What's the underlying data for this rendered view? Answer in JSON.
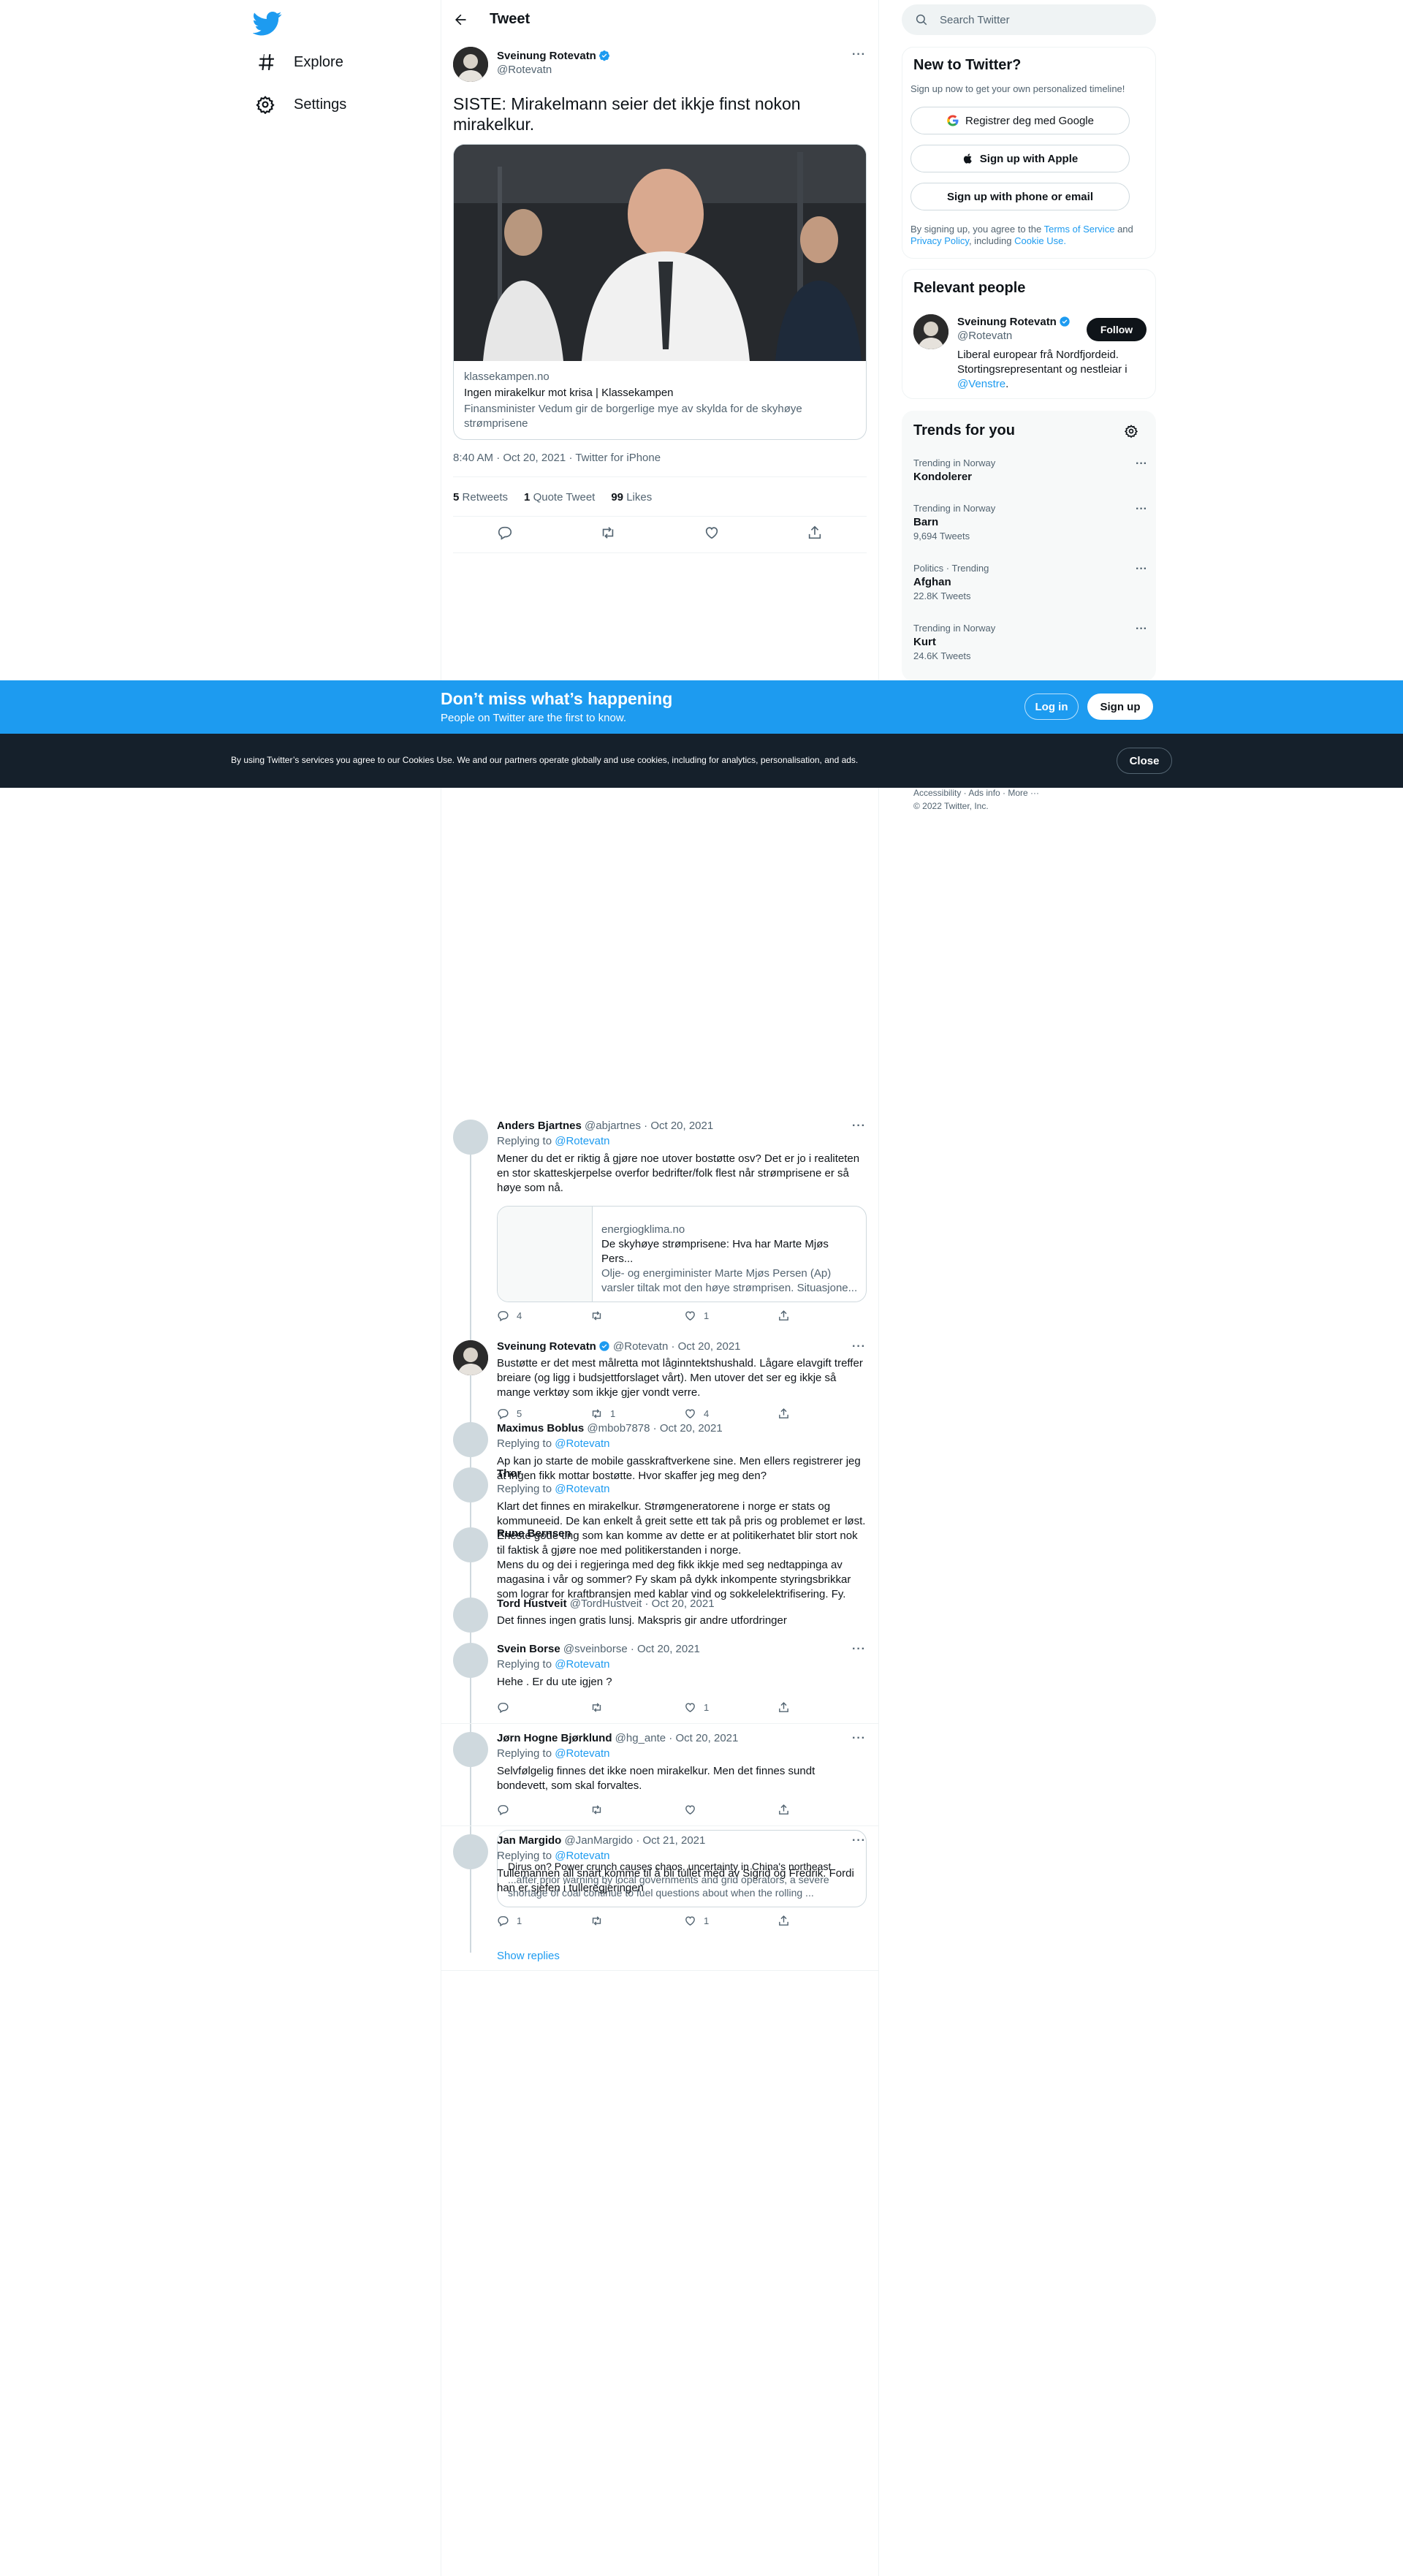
{
  "nav": {
    "explore": "Explore",
    "settings": "Settings"
  },
  "header": {
    "title": "Tweet"
  },
  "tweet": {
    "author_name": "Sveinung Rotevatn",
    "author_handle": "@Rotevatn",
    "text": "SISTE: Mirakelmann seier det ikkje finst nokon mirakelkur.",
    "card": {
      "domain": "klassekampen.no",
      "title": "Ingen mirakelkur mot krisa | Klassekampen",
      "description": "Finansminister Vedum gir de borgerlige mye av skylda for de skyhøye strømprisene"
    },
    "time": "8:40 AM · Oct 20, 2021",
    "source": "Twitter for iPhone",
    "retweets": "5",
    "retweets_label": "Retweets",
    "quotes": "1",
    "quotes_label": "Quote Tweet",
    "likes": "99",
    "likes_label": "Likes"
  },
  "search": {
    "placeholder": "Search Twitter"
  },
  "new_to_twitter": {
    "title": "New to Twitter?",
    "subtitle": "Sign up now to get your own personalized timeline!",
    "google": "Registrer deg med Google",
    "apple": "Sign up with Apple",
    "phone": "Sign up with phone or email",
    "legal_prefix": "By signing up, you agree to the",
    "terms": "Terms of Service",
    "and": "and",
    "privacy": "Privacy Policy",
    "including": ", including",
    "cookie": "Cookie Use."
  },
  "relevant": {
    "title": "Relevant people",
    "name": "Sveinung Rotevatn",
    "handle": "@Rotevatn",
    "follow": "Follow",
    "bio": "Liberal europear frå Nordfjordeid. Stortingsrepresentant og nestleiar i",
    "bio_link": "@Venstre",
    "bio_end": "."
  },
  "trends": {
    "title": "Trends for you",
    "items": [
      {
        "context": "Trending in Norway",
        "name": "Kondolerer",
        "count": ""
      },
      {
        "context": "Trending in Norway",
        "name": "Barn",
        "count": "9,694 Tweets"
      },
      {
        "context": "Politics · Trending",
        "name": "Afghan",
        "count": "22.8K Tweets"
      },
      {
        "context": "Trending in Norway",
        "name": "Kurt",
        "count": "24.6K Tweets"
      }
    ]
  },
  "footer": {
    "links": "Accessibility · Ads info · More ···",
    "copyright": "© 2022 Twitter, Inc."
  },
  "banner": {
    "title": "Don’t miss what’s happening",
    "subtitle": "People on Twitter are the first to know.",
    "login": "Log in",
    "signup": "Sign up"
  },
  "cookie_bar": {
    "text": "By using Twitter’s services you agree to our Cookies Use. We and our partners operate globally and use cookies, including for analytics, personalisation, and ads.",
    "close": "Close"
  },
  "replies": [
    {
      "name": "Anders Bjartnes",
      "handle": "@abjartnes",
      "date": "· Oct 20, 2021",
      "replying": "Replying to",
      "replying_to": "@Rotevatn",
      "text": "Mener du det er riktig å gjøre noe utover bostøtte osv? Det er jo i realiteten en stor skatteskjerpelse overfor bedrifter/folk flest når strømprisene er så høye som nå.",
      "card_domain": "energiogklima.no",
      "card_title": "De skyhøye strømprisene: Hva har Marte Mjøs Pers...",
      "card_desc": "Olje- og energiminister Marte Mjøs Persen (Ap) varsler tiltak mot den høye strømprisen. Situasjone...",
      "replies": "4",
      "retweets": "",
      "likes": "1"
    },
    {
      "name": "Sveinung Rotevatn",
      "handle": "@Rotevatn",
      "date": "· Oct 20, 2021",
      "text": "Bustøtte er det mest målretta mot låginntektshushald. Lågare elavgift treffer breiare (og ligg i budsjettforslaget vårt). Men utover det ser eg ikkje så mange verktøy som ikkje gjer vondt verre.",
      "replies": "5",
      "retweets": "1",
      "likes": "4"
    },
    {
      "name": "Maximus Boblus",
      "handle": "@mbob7878",
      "date": "· Oct 20, 2021",
      "replying": "Replying to",
      "replying_to": "@Rotevatn",
      "text": "Ap kan jo starte de mobile gasskraftverkene sine. Men ellers registrerer jeg at ingen fikk mottar bostøtte. Hvor skaffer jeg meg den?"
    },
    {
      "name": "Thor",
      "handle": "",
      "date": "",
      "replying": "Replying to",
      "replying_to": "@Rotevatn",
      "text": "Klart det finnes en mirakelkur. Strømgeneratorene i norge er stats og kommuneeid. De kan enkelt å greit sette ett tak på pris og problemet er løst. Eneste gode ting som kan komme av dette er at politikerhatet blir stort nok til faktisk å gjøre noe med politikerstanden i norge."
    },
    {
      "name": "Rune Bernsen",
      "handle": "",
      "date": "",
      "text": "Mens du og dei i regjeringa med deg fikk ikkje med seg nedtappinga av magasina i vår og sommer? Fy skam på dykk inkompente styringsbrikkar som lograr for kraftbransjen med kablar vind og sokkelelektrifisering. Fy."
    },
    {
      "name": "Tord Hustveit",
      "handle": "@TordHustveit",
      "date": "· Oct 20, 2021",
      "text": "Det finnes ingen gratis lunsj. Makspris gir andre utfordringer"
    },
    {
      "name": "Svein Borse",
      "handle": "@sveinborse",
      "date": "· Oct 20, 2021",
      "replying": "Replying to",
      "replying_to": "@Rotevatn",
      "text": "Hehe . Er du ute igjen ?",
      "replies": "",
      "retweets": "",
      "likes": "1"
    },
    {
      "name": "Jørn Hogne Bjørklund",
      "handle": "@hg_ante",
      "date": "· Oct 20, 2021",
      "replying": "Replying to",
      "replying_to": "@Rotevatn",
      "text": "Selvfølgelig finnes det ikke noen mirakelkur. Men det finnes sundt bondevett, som skal forvaltes.",
      "replies": "",
      "retweets": "",
      "likes": ""
    },
    {
      "name": "Jan Margido",
      "handle": "@JanMargido",
      "date": "· Oct 21, 2021",
      "replying": "Replying to",
      "replying_to": "@Rotevatn",
      "text": "Tullemannen all snart komme til å bli tullet med av Sigrid og Fredrik. Fordi han er sjefen i tulleregjeringen",
      "card_title": "Dirus on? Power crunch causes chaos, uncertainty in China's northeast",
      "card_desc": "...after prior warning by local governments and grid operators, a severe shortage of coal continue to fuel questions about when the rolling ...",
      "replies": "1",
      "retweets": "",
      "likes": "1"
    }
  ],
  "show_replies": "Show replies",
  "colors": {
    "accent": "#1d9bf0",
    "text": "#0f1419",
    "muted": "#536471",
    "cookie_bg": "#15202b"
  }
}
